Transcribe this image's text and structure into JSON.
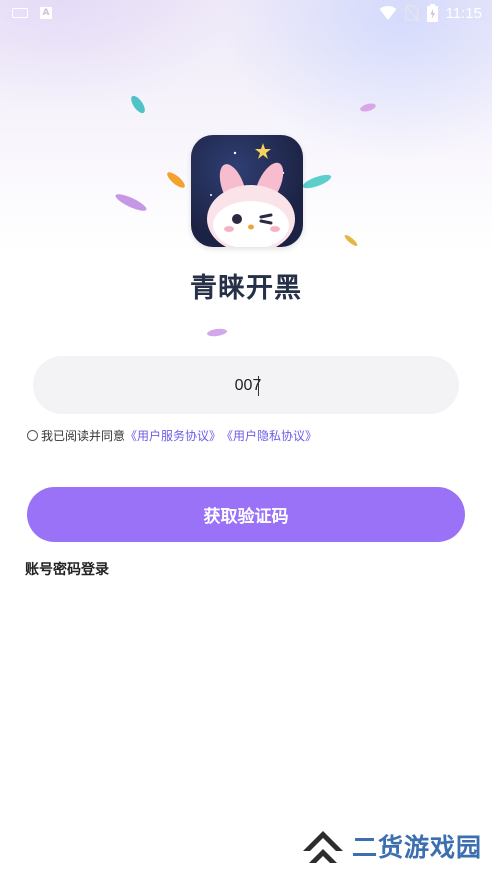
{
  "status_bar": {
    "time": "11:15",
    "left_icons": [
      "keyboard-icon",
      "a-icon"
    ],
    "right_icons": [
      "wifi-icon",
      "no-sim-icon",
      "battery-icon"
    ]
  },
  "logo": {
    "app_name": "青睐开黑"
  },
  "phone_input": {
    "value": "007"
  },
  "agreement": {
    "prefix": "我已阅读并同意",
    "service_link": "《用户服务协议》",
    "privacy_link": "《用户隐私协议》"
  },
  "primary_button": {
    "label": "获取验证码"
  },
  "alt_login": {
    "label": "账号密码登录"
  },
  "watermark": {
    "text": "二货游戏园"
  },
  "colors": {
    "primary_button": "#9a72f8",
    "link": "#6c5ce7",
    "input_bg": "#f3f3f5",
    "watermark": "#3b6fb0"
  }
}
